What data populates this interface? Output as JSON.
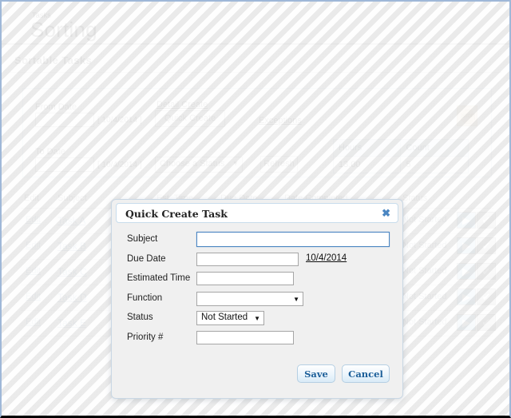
{
  "header": {
    "breadcrumb": "Tasks",
    "title": "Sorting"
  },
  "section": {
    "title": "Sortable Tasks"
  },
  "filters": {
    "from_date_label": "From Date",
    "from_date_value": "",
    "from_date_link": "[ 10/4/2014 ]",
    "from_date_link_text": "10/4/2014",
    "to_date_label": "To Date",
    "to_date_value": "",
    "to_date_link_text": "10/4/2014",
    "detail_create_link": "Detail Create",
    "quick_create_button": "Quick Create",
    "status_select_value": "Choose a Status",
    "refresh_button": "Refresh",
    "exceptions_link": "Exceptions",
    "stop_icon_label": "STOP"
  },
  "summary": {
    "headers": [
      "Hours",
      "Count"
    ],
    "values": [
      "13.00",
      "5"
    ]
  },
  "grid": {
    "columns": [
      "Edit",
      "Subject",
      "Est. Time",
      "Due Date",
      "Date Completed",
      "Status"
    ],
    "edit_label": "Edit",
    "rows": [
      {
        "edit": "Edit",
        "subject": "Task A",
        "status": "Not Started"
      },
      {
        "edit": "Edit",
        "subject": "Task B",
        "status": "Not Started"
      },
      {
        "edit": "Edit",
        "subject": "Task C",
        "status": "Not Started"
      },
      {
        "edit": "Edit",
        "subject": "Task D",
        "status": "Not Started"
      },
      {
        "edit": "Edit",
        "subject": "Task E",
        "status": "Not Started"
      }
    ],
    "play_icon": "▶",
    "complete_icon": "✔"
  },
  "modal": {
    "title": "Quick Create Task",
    "close_icon": "✖",
    "fields": {
      "subject_label": "Subject",
      "subject_value": "",
      "due_date_label": "Due Date",
      "due_date_value": "",
      "due_date_link": "10/4/2014",
      "estimated_time_label": "Estimated Time",
      "estimated_time_value": "",
      "function_label": "Function",
      "function_value": "",
      "status_label": "Status",
      "status_value": "Not Started",
      "priority_label": "Priority #",
      "priority_value": ""
    },
    "save_button": "Save",
    "cancel_button": "Cancel"
  },
  "colors": {
    "accent": "#4b86c2",
    "page_border": "#9fb8d8",
    "modal_body": "#f0f0f0"
  }
}
